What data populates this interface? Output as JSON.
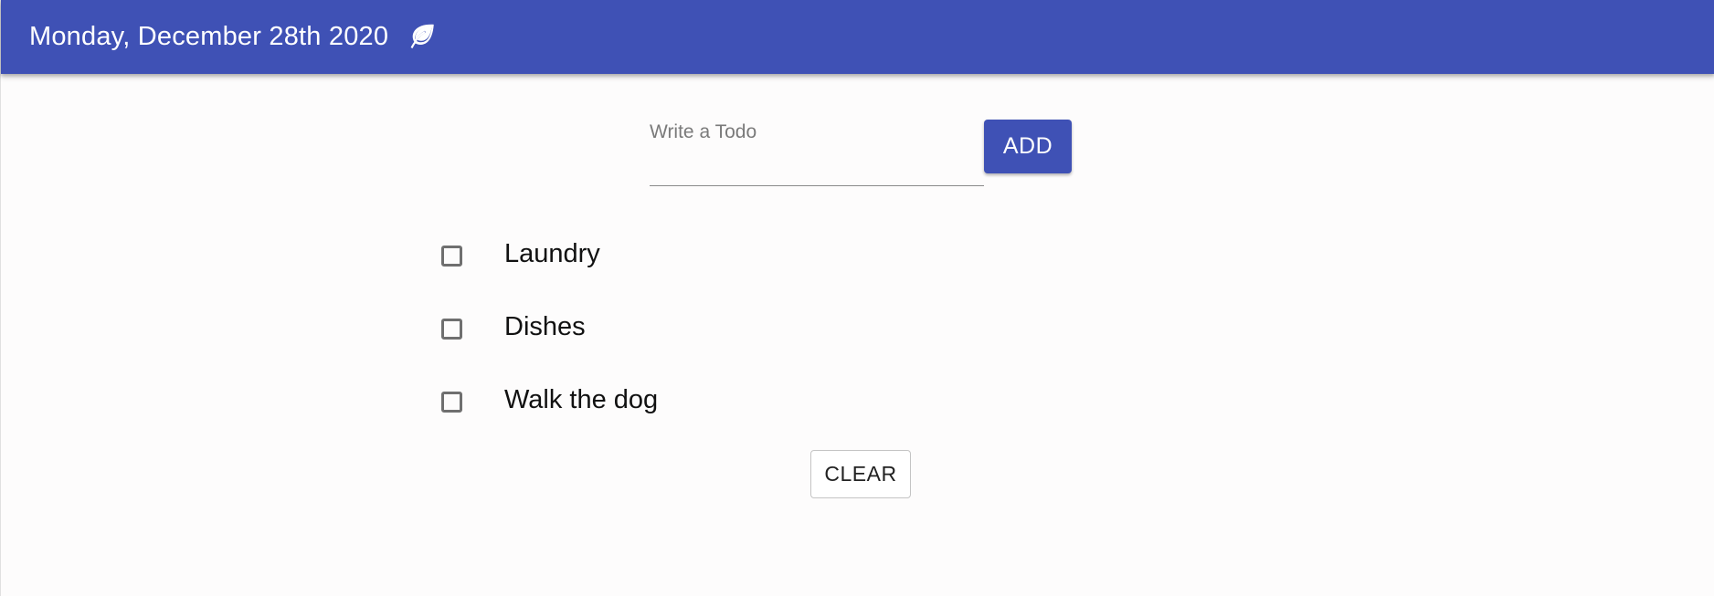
{
  "header": {
    "title": "Monday, December 28th 2020",
    "icon": "leaf-icon",
    "background_color": "#3f51b5"
  },
  "todo_form": {
    "input_value": "",
    "input_placeholder": "Write a Todo",
    "add_label": "ADD"
  },
  "todos": {
    "items": [
      {
        "label": "Laundry",
        "checked": false
      },
      {
        "label": "Dishes",
        "checked": false
      },
      {
        "label": "Walk the dog",
        "checked": false
      }
    ]
  },
  "actions": {
    "clear_label": "CLEAR"
  }
}
